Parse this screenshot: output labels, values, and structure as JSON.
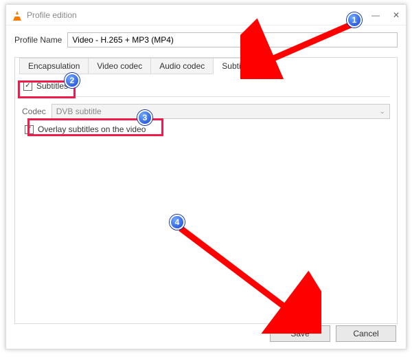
{
  "window": {
    "title": "Profile edition"
  },
  "profile": {
    "label": "Profile Name",
    "value": "Video - H.265 + MP3 (MP4)"
  },
  "tabs": {
    "encapsulation": "Encapsulation",
    "video_codec": "Video codec",
    "audio_codec": "Audio codec",
    "subtitles": "Subtitles"
  },
  "subtitles_panel": {
    "enable_label": "Subtitles",
    "codec_label": "Codec",
    "codec_value": "DVB subtitle",
    "overlay_label": "Overlay subtitles on the video"
  },
  "buttons": {
    "save": "Save",
    "cancel": "Cancel"
  },
  "annotations": {
    "b1": "1",
    "b2": "2",
    "b3": "3",
    "b4": "4"
  }
}
